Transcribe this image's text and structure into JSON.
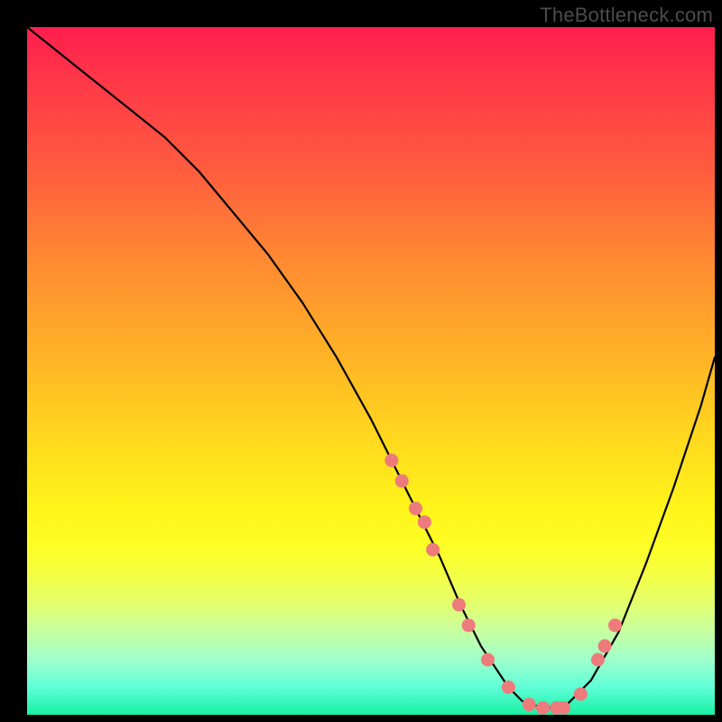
{
  "watermark": "TheBottleneck.com",
  "chart_data": {
    "type": "line",
    "title": "",
    "xlabel": "",
    "ylabel": "",
    "xlim": [
      0,
      100
    ],
    "ylim": [
      0,
      100
    ],
    "series": [
      {
        "name": "curve",
        "x": [
          0,
          5,
          10,
          15,
          20,
          25,
          30,
          35,
          40,
          45,
          50,
          53,
          56,
          60,
          63,
          66,
          70,
          72,
          75,
          78,
          82,
          86,
          90,
          94,
          98,
          100
        ],
        "y": [
          100,
          96,
          92,
          88,
          84,
          79,
          73,
          67,
          60,
          52,
          43,
          37,
          31,
          23,
          16,
          10,
          4,
          2,
          1,
          1,
          5,
          12,
          22,
          33,
          45,
          52
        ]
      }
    ],
    "points": {
      "name": "dots",
      "color": "#ee7b7b",
      "x": [
        53.0,
        54.5,
        56.5,
        57.8,
        59.0,
        62.8,
        64.2,
        67.0,
        70.0,
        73.0,
        75.0,
        77.0,
        78.0,
        80.5,
        83.0,
        84.0,
        85.5
      ],
      "y": [
        37.0,
        34.0,
        30.0,
        28.0,
        24.0,
        16.0,
        13.0,
        8.0,
        4.0,
        1.5,
        1.0,
        1.0,
        1.0,
        3.0,
        8.0,
        10.0,
        13.0
      ]
    },
    "gradient_stops": [
      {
        "pct": 0,
        "color": "#ff1d4e"
      },
      {
        "pct": 50,
        "color": "#ffd91e"
      },
      {
        "pct": 80,
        "color": "#f3ff47"
      },
      {
        "pct": 100,
        "color": "#18f0a3"
      }
    ]
  }
}
